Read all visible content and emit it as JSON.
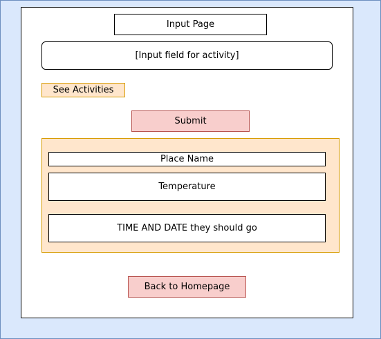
{
  "page": {
    "title": "Input Page",
    "activity_input_placeholder": "[Input field for activity]",
    "see_activities_label": "See Activities",
    "submit_label": "Submit",
    "results": {
      "place_name": "Place Name",
      "temperature": "Temperature",
      "time_and_date": "TIME AND DATE they should go"
    },
    "back_label": "Back to Homepage"
  },
  "colors": {
    "background_fill": "#dae8fc",
    "background_stroke": "#6c8ebf",
    "orange_fill": "#ffe6cc",
    "orange_stroke": "#d79b00",
    "red_fill": "#f8cecc",
    "red_stroke": "#b85450"
  }
}
